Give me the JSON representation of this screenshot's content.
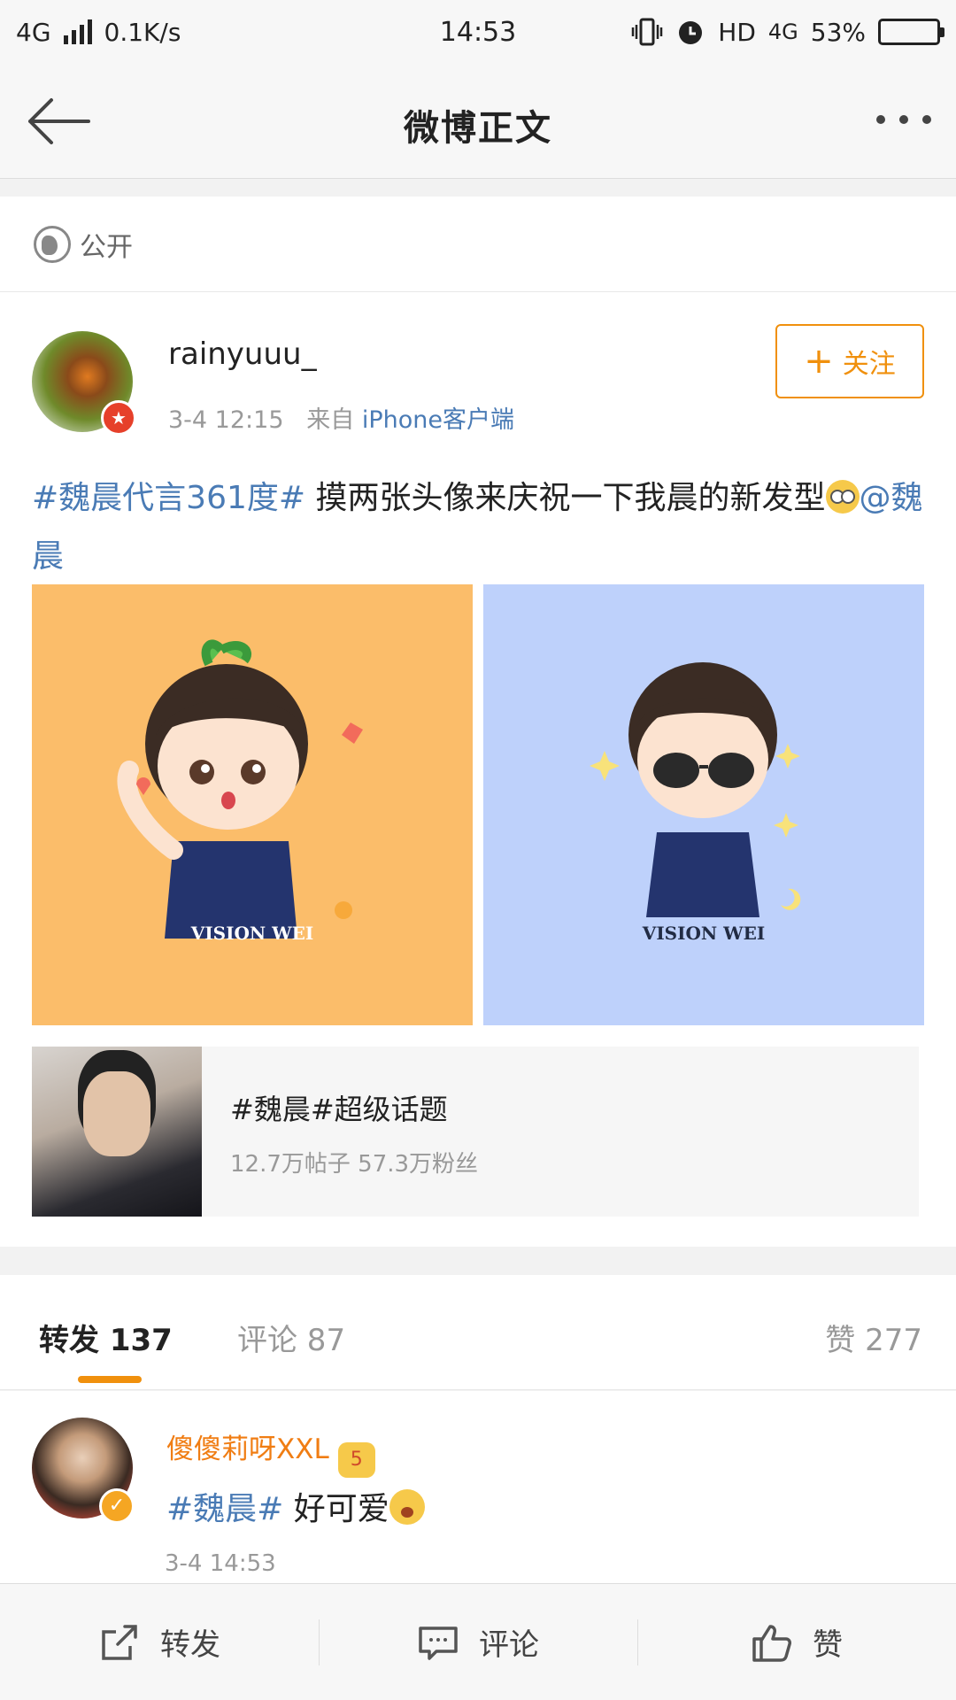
{
  "status_bar": {
    "network": "4G",
    "speed": "0.1K/s",
    "time": "14:53",
    "hd": "HD",
    "network_right": "4G",
    "battery": "53%",
    "battery_level": 0.53
  },
  "nav": {
    "title": "微博正文"
  },
  "post": {
    "visibility": "公开",
    "username": "rainyuuu_",
    "date": "3-4 12:15",
    "source_prefix": "来自",
    "source": "iPhone客户端",
    "follow_label": "关注",
    "hashtag": "#魏晨代言361度#",
    "text": " 摸两张头像来庆祝一下我晨的新发型",
    "mention": "@魏晨",
    "images": [
      {
        "brand": "VISION WEI",
        "bg": "#fbbd6a"
      },
      {
        "brand": "VISION WEI",
        "bg": "#bed1fb"
      }
    ],
    "topic": {
      "title": "#魏晨#超级话题",
      "stats": "12.7万帖子 57.3万粉丝"
    }
  },
  "tabs": {
    "repost": "转发 137",
    "comment": "评论 87",
    "like": "赞 277"
  },
  "repost_item": {
    "username": "傻傻莉呀XXL",
    "level": "5",
    "hashtag": "#魏晨#",
    "text": " 好可爱",
    "time": "3-4 14:53"
  },
  "bottom_bar": {
    "repost": "转发",
    "comment": "评论",
    "like": "赞"
  },
  "colors": {
    "accent": "#f0900d",
    "link": "#4a7bb5"
  }
}
